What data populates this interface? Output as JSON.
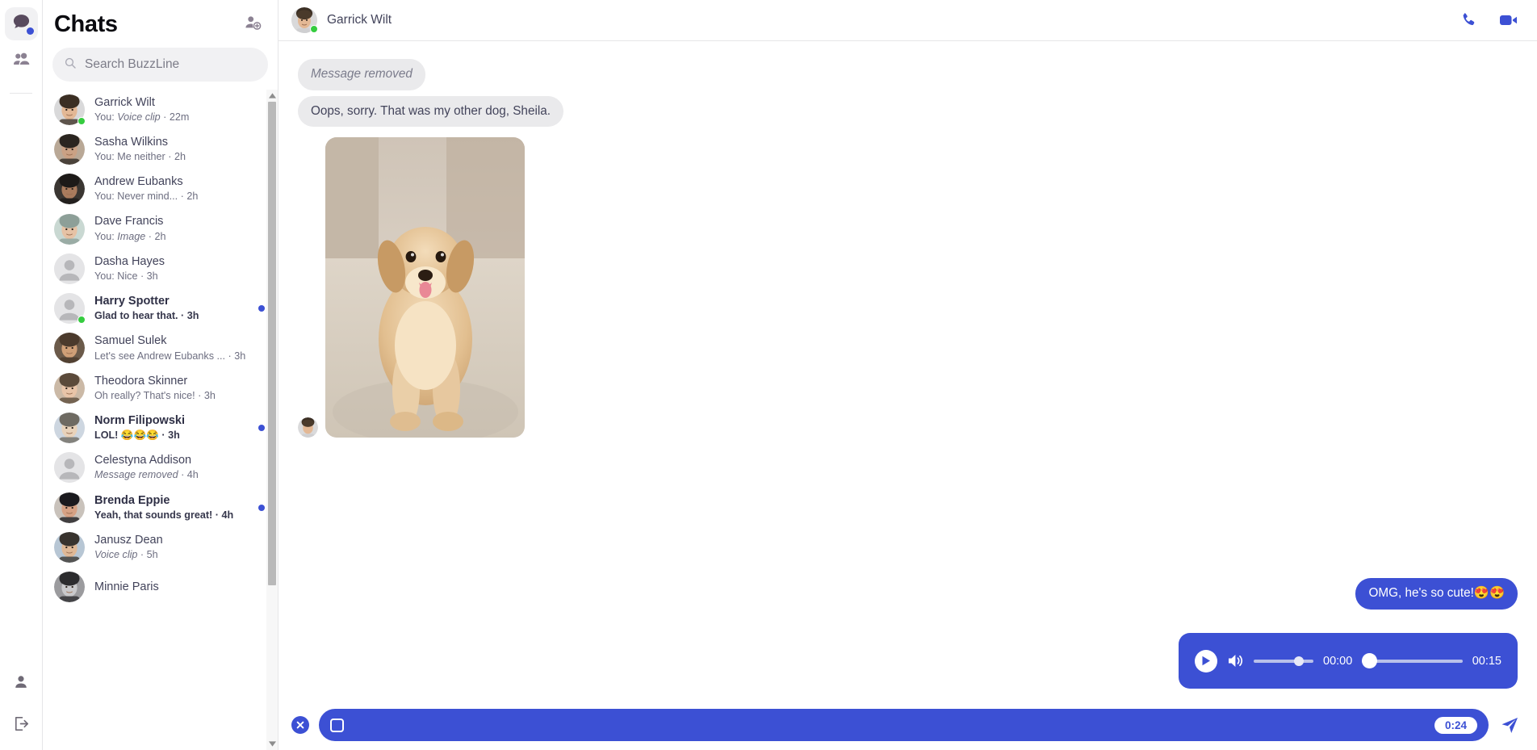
{
  "app": {
    "name": "BuzzLine",
    "accent": "#3c50d4",
    "online_color": "#35cc3f"
  },
  "rail": {
    "items": [
      {
        "name": "chats",
        "icon": "chat-bubble-icon",
        "active": true,
        "badge": true
      },
      {
        "name": "contacts",
        "icon": "people-icon",
        "active": false,
        "badge": false
      }
    ],
    "bottom": [
      {
        "name": "profile",
        "icon": "person-icon"
      },
      {
        "name": "logout",
        "icon": "logout-icon"
      }
    ]
  },
  "sidebar": {
    "title": "Chats",
    "new_chat_icon": "add-person-icon",
    "search": {
      "placeholder": "Search BuzzLine",
      "value": "",
      "icon": "search-icon"
    },
    "threads": [
      {
        "name": "Garrick Wilt",
        "preview_prefix": "You: ",
        "preview": "Voice clip",
        "preview_italic": true,
        "time": "22m",
        "online": true,
        "unread": false,
        "avatar": "photo"
      },
      {
        "name": "Sasha Wilkins",
        "preview_prefix": "You: ",
        "preview": "Me neither",
        "preview_italic": false,
        "time": "2h",
        "online": false,
        "unread": false,
        "avatar": "photo"
      },
      {
        "name": "Andrew Eubanks",
        "preview_prefix": "You: ",
        "preview": "Never mind...",
        "preview_italic": false,
        "time": "2h",
        "online": false,
        "unread": false,
        "avatar": "photo"
      },
      {
        "name": "Dave Francis",
        "preview_prefix": "You: ",
        "preview": "Image",
        "preview_italic": true,
        "time": "2h",
        "online": false,
        "unread": false,
        "avatar": "photo"
      },
      {
        "name": "Dasha Hayes",
        "preview_prefix": "You: ",
        "preview": "Nice",
        "preview_italic": false,
        "time": "3h",
        "online": false,
        "unread": false,
        "avatar": "placeholder"
      },
      {
        "name": "Harry Spotter",
        "preview_prefix": "",
        "preview": "Glad to hear that.",
        "preview_italic": false,
        "time": "3h",
        "online": true,
        "unread": true,
        "avatar": "placeholder"
      },
      {
        "name": "Samuel Sulek",
        "preview_prefix": "",
        "preview": "Let's see Andrew Eubanks ...",
        "preview_italic": false,
        "time": "3h",
        "online": false,
        "unread": false,
        "avatar": "photo"
      },
      {
        "name": "Theodora Skinner",
        "preview_prefix": "",
        "preview": "Oh really? That's nice!",
        "preview_italic": false,
        "time": "3h",
        "online": false,
        "unread": false,
        "avatar": "photo"
      },
      {
        "name": "Norm Filipowski",
        "preview_prefix": "",
        "preview": "LOL! 😂😂😂",
        "preview_italic": false,
        "time": "3h",
        "online": false,
        "unread": true,
        "avatar": "photo"
      },
      {
        "name": "Celestyna Addison",
        "preview_prefix": "",
        "preview": "Message removed",
        "preview_italic": true,
        "time": "4h",
        "online": false,
        "unread": false,
        "avatar": "placeholder"
      },
      {
        "name": "Brenda Eppie",
        "preview_prefix": "",
        "preview": "Yeah, that sounds great!",
        "preview_italic": false,
        "time": "4h",
        "online": false,
        "unread": true,
        "avatar": "photo"
      },
      {
        "name": "Janusz Dean",
        "preview_prefix": "",
        "preview": "Voice clip",
        "preview_italic": true,
        "time": "5h",
        "online": false,
        "unread": false,
        "avatar": "photo"
      },
      {
        "name": "Minnie Paris",
        "preview_prefix": "",
        "preview": "",
        "preview_italic": false,
        "time": "",
        "online": false,
        "unread": false,
        "avatar": "photo"
      }
    ]
  },
  "conversation": {
    "contact_name": "Garrick Wilt",
    "contact_online": true,
    "actions": [
      {
        "name": "voice-call",
        "icon": "phone-icon"
      },
      {
        "name": "video-call",
        "icon": "video-camera-icon"
      }
    ],
    "messages": [
      {
        "from": "them",
        "text": "Message removed",
        "removed": true
      },
      {
        "from": "them",
        "text": "Oops, sorry. That was my other dog, Sheila.",
        "removed": false
      },
      {
        "from": "them",
        "type": "image",
        "alt": "Golden retriever puppy sitting on carpet"
      },
      {
        "from": "me",
        "text": "OMG, he's so cute!😍😍",
        "removed": false
      }
    ]
  },
  "audio_player": {
    "play_icon": "play-icon",
    "volume_icon": "volume-icon",
    "current_time": "00:00",
    "total_time": "00:15",
    "volume_percent": 76,
    "progress_percent": 0
  },
  "composer": {
    "cancel_icon": "close-circle-icon",
    "stop_icon": "stop-recording-icon",
    "recording_time": "0:24",
    "send_icon": "send-icon"
  }
}
